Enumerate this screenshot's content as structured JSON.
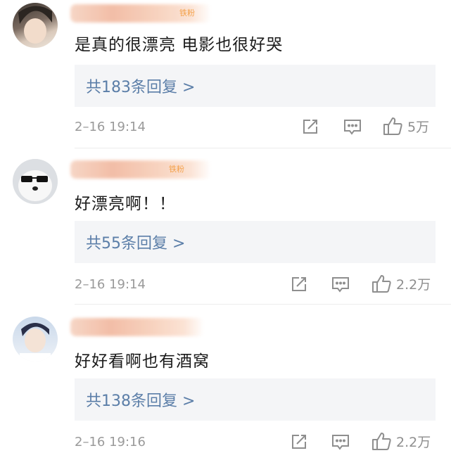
{
  "comments": [
    {
      "fan_badge": "铁粉",
      "text": "是真的很漂亮 电影也很好哭",
      "replies": "共183条回复 >",
      "time": "2–16 19:14",
      "likes": "5万",
      "avatar": "avatar-girl"
    },
    {
      "fan_badge": "铁粉",
      "text": "好漂亮啊！！",
      "replies": "共55条回复 >",
      "time": "2–16 19:14",
      "likes": "2.2万",
      "avatar": "avatar-dog-sunglasses"
    },
    {
      "fan_badge": "",
      "text": "好好看啊也有酒窝",
      "replies": "共138条回复 >",
      "time": "2–16 19:16",
      "likes": "2.2万",
      "avatar": "avatar-boy"
    }
  ],
  "icons": {
    "share": "share-icon",
    "comment": "comment-icon",
    "like": "thumbs-up-icon"
  },
  "colors": {
    "reply_link": "#5b7ea8",
    "reply_bg": "#f4f5f7",
    "meta": "#9a9a9a"
  }
}
